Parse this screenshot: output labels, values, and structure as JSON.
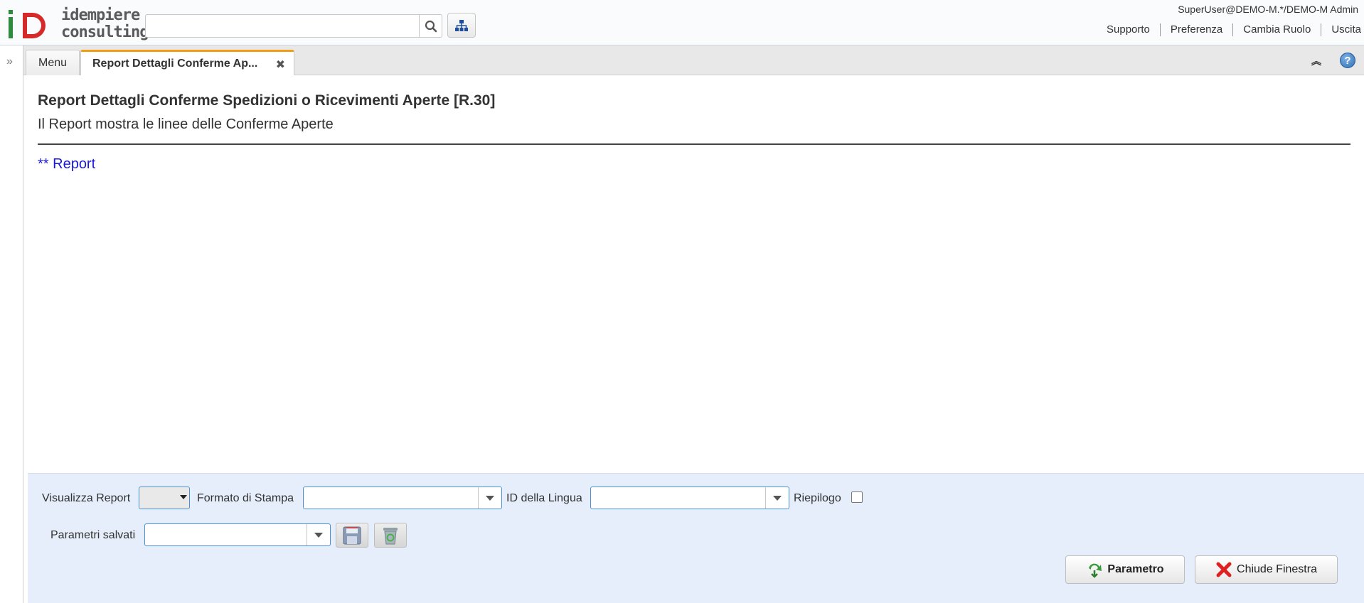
{
  "header": {
    "logo_line1": "idempiere",
    "logo_line2": "consulting",
    "search_placeholder": "",
    "user_info": "SuperUser@DEMO-M.*/DEMO-M Admin",
    "links": [
      "Supporto",
      "Preferenza",
      "Cambia Ruolo",
      "Uscita"
    ]
  },
  "tabs": {
    "menu_label": "Menu",
    "active_label": "Report Dettagli Conferme Ap...",
    "accent_color": "#f39c12"
  },
  "process": {
    "title": "Report Dettagli Conferme Spedizioni o Ricevimenti Aperte [R.30]",
    "description": "Il Report mostra le linee delle Conferme Aperte",
    "help": "** Report"
  },
  "parameters": {
    "view_report_label": "Visualizza Report",
    "view_report_value": "",
    "print_format_label": "Formato di Stampa",
    "print_format_value": "",
    "language_label": "ID della Lingua",
    "language_value": "",
    "summary_label": "Riepilogo",
    "summary_checked": false,
    "saved_params_label": "Parametri salvati",
    "saved_params_value": ""
  },
  "buttons": {
    "parameter_label": "Parametro",
    "close_label": "Chiude Finestra"
  },
  "icons": {
    "search": "search-icon",
    "tree": "sitemap-icon",
    "expand": "double-chevron-right-icon",
    "close_tab": "close-icon",
    "collapse": "double-chevron-up-icon",
    "help": "help-icon",
    "save": "floppy-disk-icon",
    "delete": "recycle-bin-icon",
    "parameter": "green-arrow-icon",
    "close_window": "red-x-icon"
  }
}
